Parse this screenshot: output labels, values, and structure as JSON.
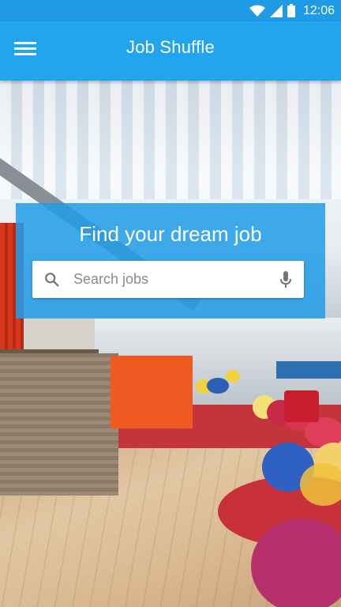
{
  "status_bar": {
    "time": "12:06",
    "icons": [
      "wifi-icon",
      "signal-icon",
      "battery-icon"
    ]
  },
  "app_bar": {
    "title": "Job Shuffle",
    "menu_icon": "hamburger-menu-icon"
  },
  "search_card": {
    "heading": "Find your dream job",
    "search_placeholder": "Search jobs",
    "search_icon": "search-icon",
    "voice_icon": "mic-icon"
  },
  "colors": {
    "primary": "#21a5ef",
    "status_bar": "#1e9be4",
    "card": "#219de8"
  }
}
